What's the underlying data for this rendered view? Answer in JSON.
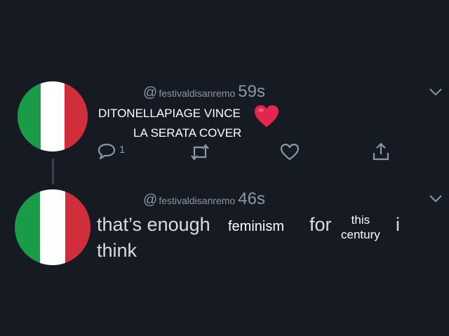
{
  "colors": {
    "background": "#151a23",
    "flag_green": "#1a9b47",
    "flag_white": "#ffffff",
    "flag_red": "#d12e3c",
    "muted": "#8b98a5",
    "heart": "#e2264d"
  },
  "tweet1": {
    "avatar_icon": "italy-flag-avatar",
    "at": "@",
    "handle": "festivaldisanremo",
    "time": "59s",
    "text_line1": "DITONELLAPIAGE VINCE",
    "text_line2": "LA SERATA COVER",
    "emoji_icon": "red-heart-emoji",
    "reply_count": "1",
    "actions": [
      "reply-icon",
      "retweet-icon",
      "like-icon",
      "share-icon"
    ]
  },
  "tweet2": {
    "avatar_icon": "italy-flag-avatar",
    "at": "@",
    "handle": "festivaldisanremo",
    "time": "46s",
    "text_part1": "that’s enough",
    "overlay1": "feminism",
    "text_part2": "for",
    "overlay2_line1": "this",
    "overlay2_line2": "century",
    "text_part3": "i",
    "text_part4": "think"
  }
}
